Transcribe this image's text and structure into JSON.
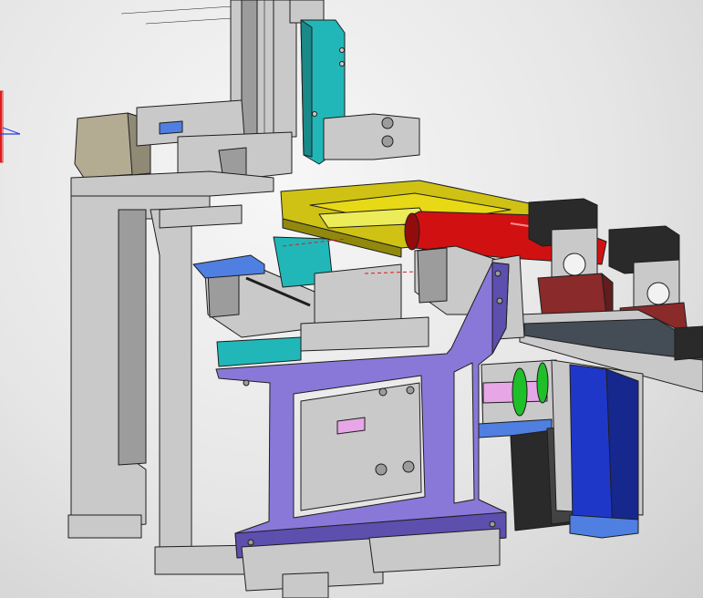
{
  "canvas": {
    "background": "#e9e9e9"
  },
  "colors": {
    "frame_gray": "#c9c9c9",
    "frame_dark": "#9c9c9c",
    "plate_purple": "#8a78d8",
    "plate_purple_dark": "#5d4fae",
    "teal": "#21b7b8",
    "olive": "#cfc214",
    "red_cone": "#d11111",
    "maroon": "#8a2a2a",
    "blue_cover": "#1f37c9",
    "beige": "#b3ab92",
    "green_belt": "#1fbf2a",
    "pink_shaft": "#e7a6e6",
    "black_motor": "#2a2a2a"
  },
  "components": [
    "vertical-column",
    "teal-cylinder",
    "beige-motor-block",
    "left-support-frame",
    "olive-plate",
    "red-conical-guide",
    "gauge-block-front",
    "gauge-block-rear",
    "aluminum-extrusion-left",
    "aluminum-extrusion-right",
    "purple-mounting-plate",
    "blue-cover",
    "black-stepper-motor",
    "green-timing-belt",
    "pink-shaft"
  ],
  "axis_triad": {
    "x_color": "#e01b1b",
    "y_color": "#2a3fd8"
  }
}
